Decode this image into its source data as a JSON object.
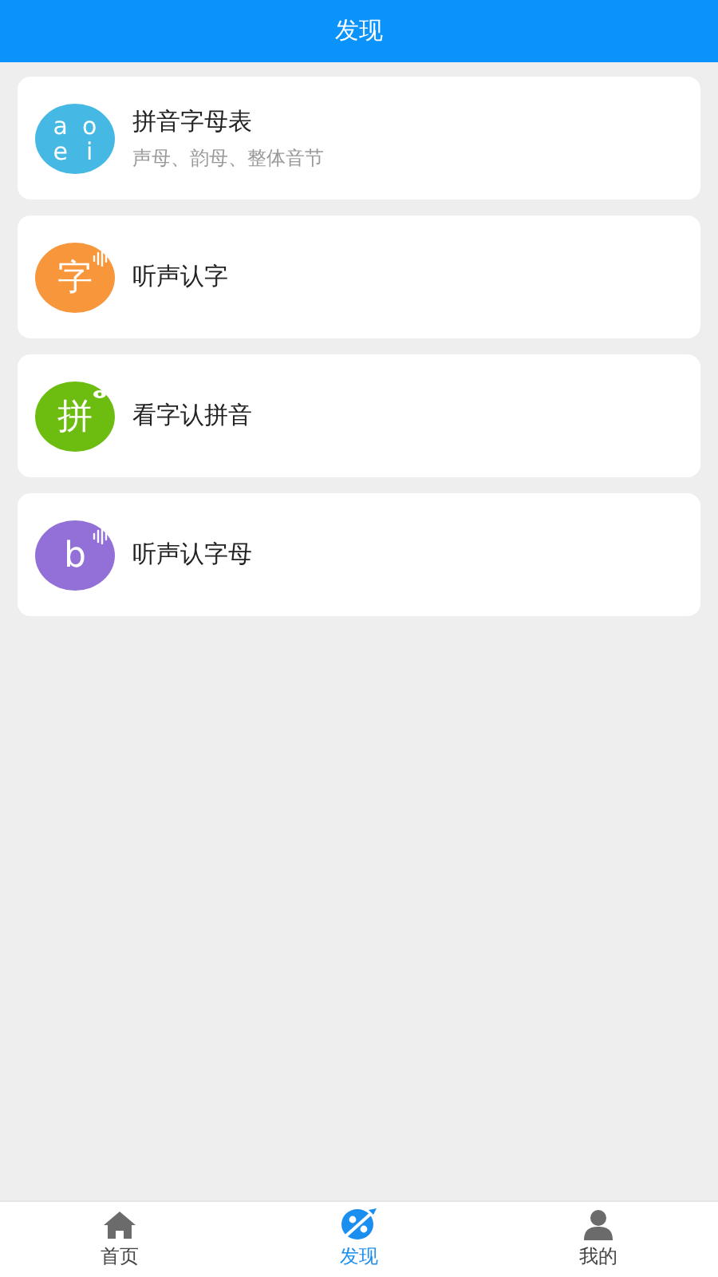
{
  "header": {
    "title": "发现"
  },
  "items": [
    {
      "badge": {
        "glyphs": [
          "a",
          "o",
          "e",
          "i"
        ],
        "color": "#45b8e4"
      },
      "title": "拼音字母表",
      "subtitle": "声母、韵母、整体音节"
    },
    {
      "badge": {
        "glyphs": [
          "字"
        ],
        "color": "#f7963b",
        "kind": "sound"
      },
      "title": "听声认字"
    },
    {
      "badge": {
        "glyphs": [
          "拼"
        ],
        "color": "#6cbd10",
        "kind": "eye"
      },
      "title": "看字认拼音"
    },
    {
      "badge": {
        "glyphs": [
          "b"
        ],
        "color": "#9370d8",
        "kind": "sound"
      },
      "title": "听声认字母"
    }
  ],
  "tabs": [
    {
      "label": "首页",
      "kind": "home",
      "selected": false
    },
    {
      "label": "发现",
      "kind": "planet",
      "selected": true
    },
    {
      "label": "我的",
      "kind": "person",
      "selected": false
    }
  ]
}
